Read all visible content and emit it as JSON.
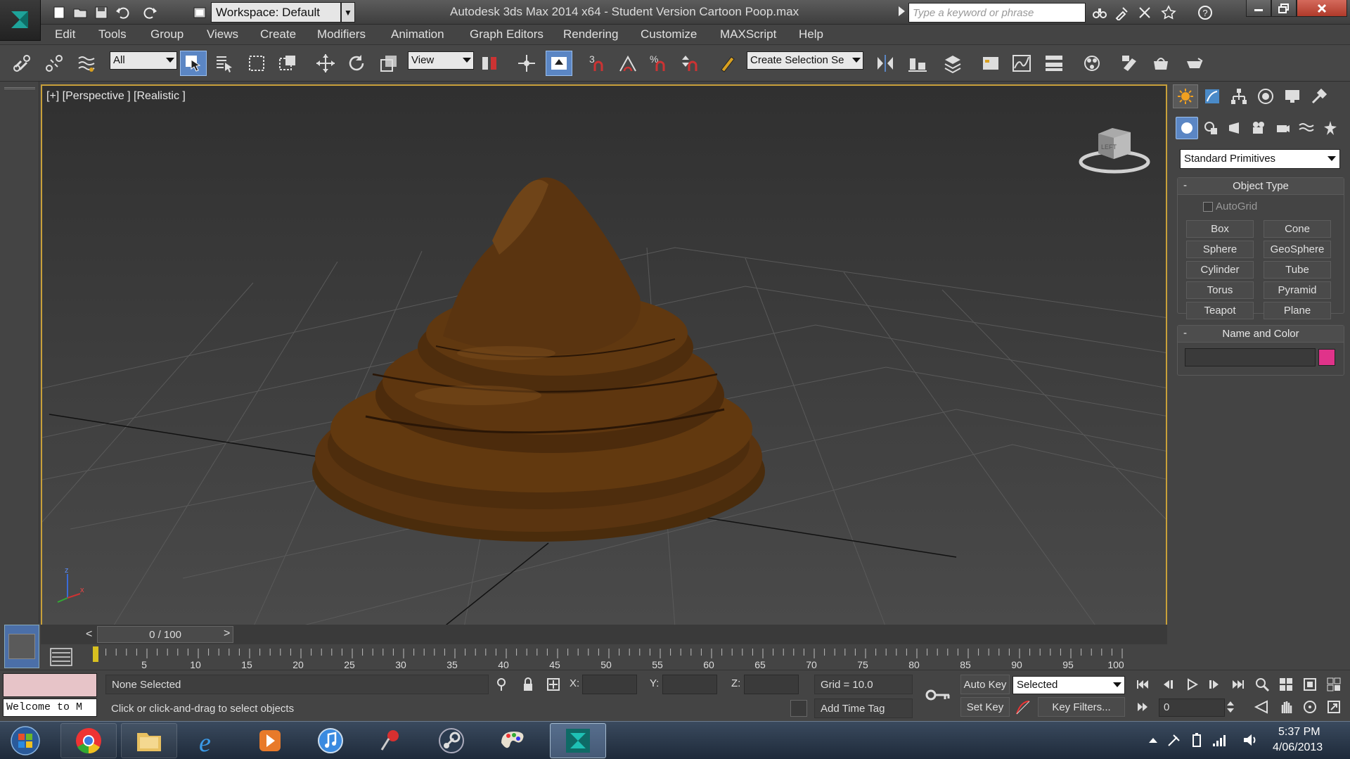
{
  "titlebar": {
    "workspace_label": "Workspace: Default",
    "app_title": "Autodesk 3ds Max  2014 x64   - Student Version     Cartoon Poop.max",
    "search_placeholder": "Type a keyword or phrase"
  },
  "menu": [
    "Edit",
    "Tools",
    "Group",
    "Views",
    "Create",
    "Modifiers",
    "Animation",
    "Graph Editors",
    "Rendering",
    "Customize",
    "MAXScript",
    "Help"
  ],
  "toolbar": {
    "selection_filter": "All",
    "reference_coord": "View",
    "named_selection": "Create Selection Se",
    "snap_label": "3",
    "angle_snap_label": "%"
  },
  "viewport": {
    "label": "[+] [Perspective ] [Realistic ]",
    "viewcube_face": "LEFT",
    "axis_z": "z",
    "axis_x": "x"
  },
  "command_panel": {
    "category": "Standard Primitives",
    "object_type": {
      "title": "Object Type",
      "collapse_symbol": "-",
      "autogrid_label": "AutoGrid",
      "buttons": [
        "Box",
        "Cone",
        "Sphere",
        "GeoSphere",
        "Cylinder",
        "Tube",
        "Torus",
        "Pyramid",
        "Teapot",
        "Plane"
      ]
    },
    "name_color": {
      "title": "Name and Color",
      "collapse_symbol": "-",
      "swatch_color": "#e0338a"
    }
  },
  "timeline": {
    "frame_display": "0 / 100",
    "prev": "<",
    "next": ">",
    "ticks": [
      "5",
      "10",
      "15",
      "20",
      "25",
      "30",
      "35",
      "40",
      "45",
      "50",
      "55",
      "60",
      "65",
      "70",
      "75",
      "80",
      "85",
      "90",
      "95",
      "100"
    ]
  },
  "status": {
    "listener_text": "Welcome to M",
    "selection": "None Selected",
    "prompt": "Click or click-and-drag to select objects",
    "x_label": "X:",
    "y_label": "Y:",
    "z_label": "Z:",
    "grid": "Grid = 10.0",
    "add_time_tag": "Add Time Tag",
    "auto_key": "Auto Key",
    "set_key": "Set Key",
    "key_mode": "Selected",
    "key_filters": "Key Filters...",
    "current_frame": "0"
  },
  "taskbar": {
    "time": "5:37 PM",
    "date": "4/06/2013",
    "apps": [
      "chrome-icon",
      "explorer-folder-icon",
      "internet-explorer-icon",
      "media-player-icon",
      "itunes-icon",
      "pin-app-icon",
      "steam-icon",
      "paint-icon",
      "3dsmax-icon"
    ]
  },
  "colors": {
    "viewport_border": "#c8a03a",
    "active_tool": "#5b86c4",
    "object_color": "#5a3410"
  }
}
